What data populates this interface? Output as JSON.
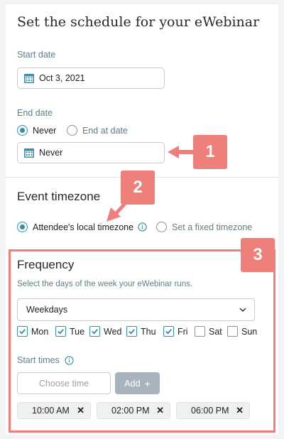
{
  "schedule": {
    "title": "Set the schedule for your eWebinar",
    "start_date_label": "Start date",
    "start_date_value": "Oct 3, 2021",
    "end_date_label": "End date",
    "end_never_label": "Never",
    "end_at_date_label": "End at date",
    "end_date_value": "Never"
  },
  "timezone": {
    "title": "Event timezone",
    "local_label": "Attendee's local timezone",
    "fixed_label": "Set a fixed timezone"
  },
  "frequency": {
    "title": "Frequency",
    "description": "Select the days of the week your eWebinar runs.",
    "selected_option": "Weekdays",
    "days": [
      {
        "label": "Mon",
        "checked": true
      },
      {
        "label": "Tue",
        "checked": true
      },
      {
        "label": "Wed",
        "checked": true
      },
      {
        "label": "Thu",
        "checked": true
      },
      {
        "label": "Fri",
        "checked": true
      },
      {
        "label": "Sat",
        "checked": false
      },
      {
        "label": "Sun",
        "checked": false
      }
    ],
    "start_times_label": "Start times",
    "choose_time_placeholder": "Choose time",
    "add_label": "Add",
    "times": [
      "10:00 AM",
      "02:00 PM",
      "06:00 PM"
    ]
  },
  "callouts": [
    "1",
    "2",
    "3"
  ],
  "colors": {
    "accent": "#3b8ea5",
    "callout": "#ef7f7a",
    "label": "#5f7f89"
  }
}
